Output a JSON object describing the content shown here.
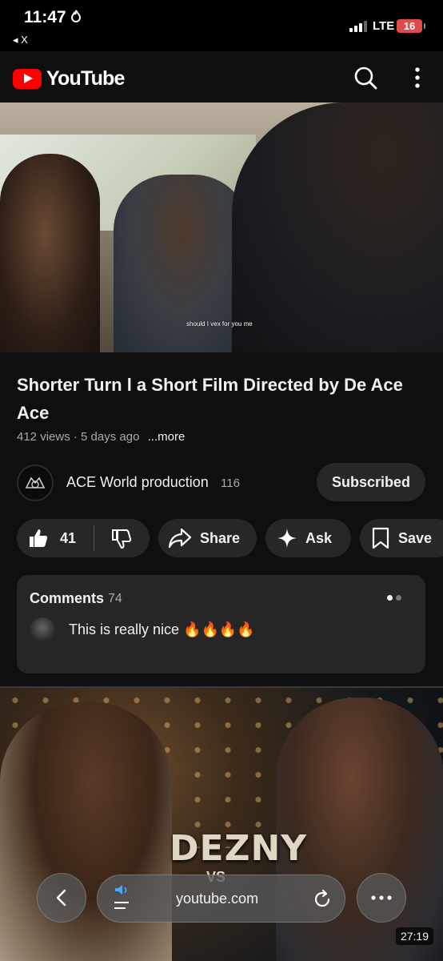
{
  "status_bar": {
    "time": "11:47",
    "back_label": "◂ X",
    "network": "LTE",
    "battery": "16"
  },
  "app_bar": {
    "logo_text": "YouTube",
    "brand_color": "#ff0000"
  },
  "video": {
    "subtitle": "should I vex for you me"
  },
  "details": {
    "title": "Shorter Turn l a Short Film Directed by De Ace Ace",
    "views": "412 views",
    "age": "5 days ago",
    "more_label": "...more"
  },
  "channel": {
    "name": "ACE World production",
    "subscribers": "116",
    "subscribe_label": "Subscribed"
  },
  "actions": {
    "like_count": "41",
    "share_label": "Share",
    "ask_label": "Ask",
    "save_label": "Save"
  },
  "comments": {
    "label": "Comments",
    "count": "74",
    "top_comment": "This is really nice 🔥🔥🔥🔥"
  },
  "next_video": {
    "overlay_text": "DEZNY",
    "overlay_sub": "VS",
    "duration": "27:19"
  },
  "browser": {
    "url": "youtube.com"
  }
}
